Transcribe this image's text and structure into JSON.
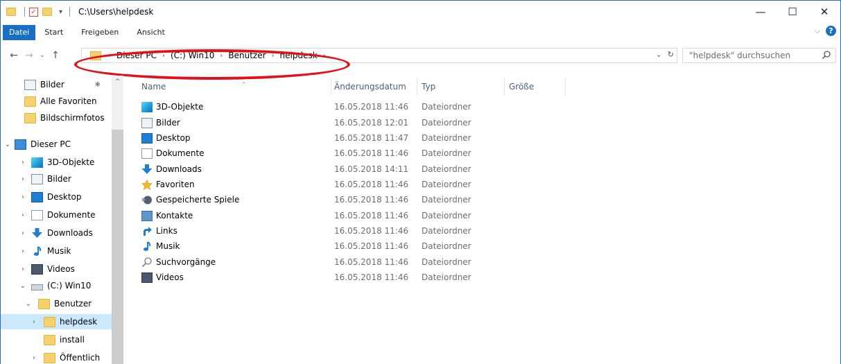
{
  "window": {
    "title": "C:\\Users\\helpdesk",
    "controls": {
      "minimize": "—",
      "maximize": "☐",
      "close": "✕"
    }
  },
  "ribbon": {
    "tabs": [
      "Datei",
      "Start",
      "Freigeben",
      "Ansicht"
    ],
    "help": "?"
  },
  "address": {
    "crumbs": [
      "Dieser PC",
      "(C:) Win10",
      "Benutzer",
      "helpdesk"
    ],
    "search_placeholder": "\"helpdesk\" durchsuchen"
  },
  "columns": [
    "Name",
    "Änderungsdatum",
    "Typ",
    "Größe"
  ],
  "files": [
    {
      "name": "3D-Objekte",
      "date": "16.05.2018 11:46",
      "type": "Dateiordner",
      "icon": "3d-objects-icon"
    },
    {
      "name": "Bilder",
      "date": "16.05.2018 12:01",
      "type": "Dateiordner",
      "icon": "pictures-icon"
    },
    {
      "name": "Desktop",
      "date": "16.05.2018 11:47",
      "type": "Dateiordner",
      "icon": "desktop-icon"
    },
    {
      "name": "Dokumente",
      "date": "16.05.2018 11:46",
      "type": "Dateiordner",
      "icon": "documents-icon"
    },
    {
      "name": "Downloads",
      "date": "16.05.2018 14:11",
      "type": "Dateiordner",
      "icon": "downloads-icon"
    },
    {
      "name": "Favoriten",
      "date": "16.05.2018 11:46",
      "type": "Dateiordner",
      "icon": "favorites-star-icon"
    },
    {
      "name": "Gespeicherte Spiele",
      "date": "16.05.2018 11:46",
      "type": "Dateiordner",
      "icon": "saved-games-icon"
    },
    {
      "name": "Kontakte",
      "date": "16.05.2018 11:46",
      "type": "Dateiordner",
      "icon": "contacts-icon"
    },
    {
      "name": "Links",
      "date": "16.05.2018 11:46",
      "type": "Dateiordner",
      "icon": "links-icon"
    },
    {
      "name": "Musik",
      "date": "16.05.2018 11:46",
      "type": "Dateiordner",
      "icon": "music-icon"
    },
    {
      "name": "Suchvorgänge",
      "date": "16.05.2018 11:46",
      "type": "Dateiordner",
      "icon": "searches-icon"
    },
    {
      "name": "Videos",
      "date": "16.05.2018 11:46",
      "type": "Dateiordner",
      "icon": "videos-icon"
    }
  ],
  "sidebar": [
    {
      "label": "Bilder",
      "icon": "pictures-icon",
      "pinned": true
    },
    {
      "label": "Alle Favoriten",
      "icon": "folder-icon"
    },
    {
      "label": "Bildschirmfotos",
      "icon": "folder-icon"
    },
    {
      "label": "Dieser PC",
      "icon": "this-pc-icon",
      "expanded": true
    },
    {
      "label": "3D-Objekte",
      "icon": "3d-objects-icon"
    },
    {
      "label": "Bilder",
      "icon": "pictures-icon"
    },
    {
      "label": "Desktop",
      "icon": "desktop-icon"
    },
    {
      "label": "Dokumente",
      "icon": "documents-icon"
    },
    {
      "label": "Downloads",
      "icon": "downloads-icon"
    },
    {
      "label": "Musik",
      "icon": "music-icon"
    },
    {
      "label": "Videos",
      "icon": "videos-icon"
    },
    {
      "label": "(C:) Win10",
      "icon": "drive-icon",
      "expanded": true
    },
    {
      "label": "Benutzer",
      "icon": "folder-icon",
      "expanded": true
    },
    {
      "label": "helpdesk",
      "icon": "folder-icon",
      "selected": true
    },
    {
      "label": "install",
      "icon": "folder-icon"
    },
    {
      "label": "Öffentlich",
      "icon": "folder-icon"
    }
  ],
  "colors": {
    "accent": "#1b6fc2",
    "selection": "#cce8ff",
    "annotation": "#e3101a",
    "folder": "#f7d26c"
  }
}
